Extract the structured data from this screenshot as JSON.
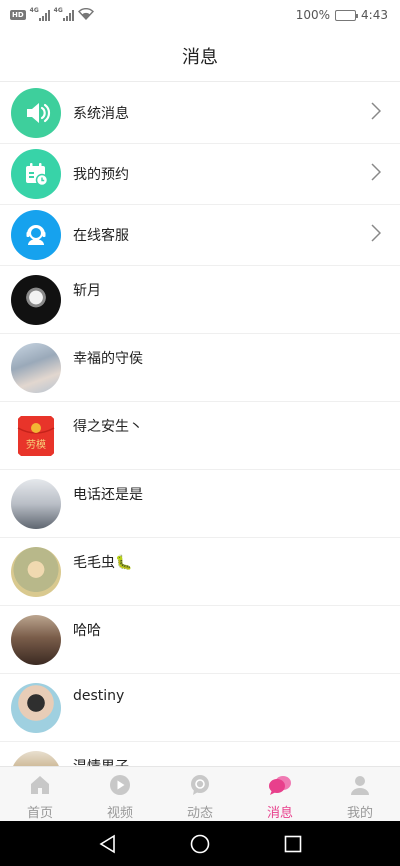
{
  "status_bar": {
    "hd": "HD",
    "net1": "4G",
    "net2": "4G",
    "battery": "100%",
    "time": "4:43"
  },
  "header": {
    "title": "消息"
  },
  "system_items": [
    {
      "label": "系统消息",
      "icon": "speaker-icon",
      "color": "#3ecf9c"
    },
    {
      "label": "我的预约",
      "icon": "calendar-icon",
      "color": "#38d3a8"
    },
    {
      "label": "在线客服",
      "icon": "headset-icon",
      "color": "#16a2ee"
    }
  ],
  "conversations": [
    {
      "name": "斩月"
    },
    {
      "name": "幸福的守侯"
    },
    {
      "name": "得之安生丶",
      "avatar_text": "劳模"
    },
    {
      "name": "电话还是是"
    },
    {
      "name": "毛毛虫🐛"
    },
    {
      "name": "哈哈"
    },
    {
      "name": "destiny"
    },
    {
      "name": "温情男子"
    }
  ],
  "tabbar": {
    "active_color": "#e8408c",
    "items": [
      {
        "label": "首页",
        "icon": "home-icon"
      },
      {
        "label": "视频",
        "icon": "play-icon"
      },
      {
        "label": "动态",
        "icon": "chat-bubble-icon"
      },
      {
        "label": "消息",
        "icon": "messages-icon",
        "active": true
      },
      {
        "label": "我的",
        "icon": "user-icon"
      }
    ]
  }
}
